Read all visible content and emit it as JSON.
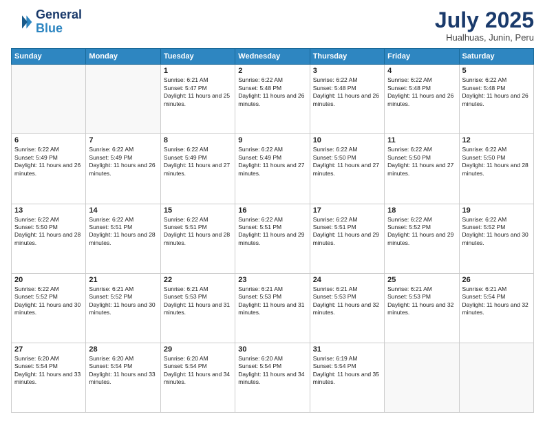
{
  "header": {
    "logo_line1": "General",
    "logo_line2": "Blue",
    "month_year": "July 2025",
    "location": "Hualhuas, Junin, Peru"
  },
  "days_of_week": [
    "Sunday",
    "Monday",
    "Tuesday",
    "Wednesday",
    "Thursday",
    "Friday",
    "Saturday"
  ],
  "weeks": [
    [
      {
        "day": "",
        "sunrise": "",
        "sunset": "",
        "daylight": ""
      },
      {
        "day": "",
        "sunrise": "",
        "sunset": "",
        "daylight": ""
      },
      {
        "day": "1",
        "sunrise": "Sunrise: 6:21 AM",
        "sunset": "Sunset: 5:47 PM",
        "daylight": "Daylight: 11 hours and 25 minutes."
      },
      {
        "day": "2",
        "sunrise": "Sunrise: 6:22 AM",
        "sunset": "Sunset: 5:48 PM",
        "daylight": "Daylight: 11 hours and 26 minutes."
      },
      {
        "day": "3",
        "sunrise": "Sunrise: 6:22 AM",
        "sunset": "Sunset: 5:48 PM",
        "daylight": "Daylight: 11 hours and 26 minutes."
      },
      {
        "day": "4",
        "sunrise": "Sunrise: 6:22 AM",
        "sunset": "Sunset: 5:48 PM",
        "daylight": "Daylight: 11 hours and 26 minutes."
      },
      {
        "day": "5",
        "sunrise": "Sunrise: 6:22 AM",
        "sunset": "Sunset: 5:48 PM",
        "daylight": "Daylight: 11 hours and 26 minutes."
      }
    ],
    [
      {
        "day": "6",
        "sunrise": "Sunrise: 6:22 AM",
        "sunset": "Sunset: 5:49 PM",
        "daylight": "Daylight: 11 hours and 26 minutes."
      },
      {
        "day": "7",
        "sunrise": "Sunrise: 6:22 AM",
        "sunset": "Sunset: 5:49 PM",
        "daylight": "Daylight: 11 hours and 26 minutes."
      },
      {
        "day": "8",
        "sunrise": "Sunrise: 6:22 AM",
        "sunset": "Sunset: 5:49 PM",
        "daylight": "Daylight: 11 hours and 27 minutes."
      },
      {
        "day": "9",
        "sunrise": "Sunrise: 6:22 AM",
        "sunset": "Sunset: 5:49 PM",
        "daylight": "Daylight: 11 hours and 27 minutes."
      },
      {
        "day": "10",
        "sunrise": "Sunrise: 6:22 AM",
        "sunset": "Sunset: 5:50 PM",
        "daylight": "Daylight: 11 hours and 27 minutes."
      },
      {
        "day": "11",
        "sunrise": "Sunrise: 6:22 AM",
        "sunset": "Sunset: 5:50 PM",
        "daylight": "Daylight: 11 hours and 27 minutes."
      },
      {
        "day": "12",
        "sunrise": "Sunrise: 6:22 AM",
        "sunset": "Sunset: 5:50 PM",
        "daylight": "Daylight: 11 hours and 28 minutes."
      }
    ],
    [
      {
        "day": "13",
        "sunrise": "Sunrise: 6:22 AM",
        "sunset": "Sunset: 5:50 PM",
        "daylight": "Daylight: 11 hours and 28 minutes."
      },
      {
        "day": "14",
        "sunrise": "Sunrise: 6:22 AM",
        "sunset": "Sunset: 5:51 PM",
        "daylight": "Daylight: 11 hours and 28 minutes."
      },
      {
        "day": "15",
        "sunrise": "Sunrise: 6:22 AM",
        "sunset": "Sunset: 5:51 PM",
        "daylight": "Daylight: 11 hours and 28 minutes."
      },
      {
        "day": "16",
        "sunrise": "Sunrise: 6:22 AM",
        "sunset": "Sunset: 5:51 PM",
        "daylight": "Daylight: 11 hours and 29 minutes."
      },
      {
        "day": "17",
        "sunrise": "Sunrise: 6:22 AM",
        "sunset": "Sunset: 5:51 PM",
        "daylight": "Daylight: 11 hours and 29 minutes."
      },
      {
        "day": "18",
        "sunrise": "Sunrise: 6:22 AM",
        "sunset": "Sunset: 5:52 PM",
        "daylight": "Daylight: 11 hours and 29 minutes."
      },
      {
        "day": "19",
        "sunrise": "Sunrise: 6:22 AM",
        "sunset": "Sunset: 5:52 PM",
        "daylight": "Daylight: 11 hours and 30 minutes."
      }
    ],
    [
      {
        "day": "20",
        "sunrise": "Sunrise: 6:22 AM",
        "sunset": "Sunset: 5:52 PM",
        "daylight": "Daylight: 11 hours and 30 minutes."
      },
      {
        "day": "21",
        "sunrise": "Sunrise: 6:21 AM",
        "sunset": "Sunset: 5:52 PM",
        "daylight": "Daylight: 11 hours and 30 minutes."
      },
      {
        "day": "22",
        "sunrise": "Sunrise: 6:21 AM",
        "sunset": "Sunset: 5:53 PM",
        "daylight": "Daylight: 11 hours and 31 minutes."
      },
      {
        "day": "23",
        "sunrise": "Sunrise: 6:21 AM",
        "sunset": "Sunset: 5:53 PM",
        "daylight": "Daylight: 11 hours and 31 minutes."
      },
      {
        "day": "24",
        "sunrise": "Sunrise: 6:21 AM",
        "sunset": "Sunset: 5:53 PM",
        "daylight": "Daylight: 11 hours and 32 minutes."
      },
      {
        "day": "25",
        "sunrise": "Sunrise: 6:21 AM",
        "sunset": "Sunset: 5:53 PM",
        "daylight": "Daylight: 11 hours and 32 minutes."
      },
      {
        "day": "26",
        "sunrise": "Sunrise: 6:21 AM",
        "sunset": "Sunset: 5:54 PM",
        "daylight": "Daylight: 11 hours and 32 minutes."
      }
    ],
    [
      {
        "day": "27",
        "sunrise": "Sunrise: 6:20 AM",
        "sunset": "Sunset: 5:54 PM",
        "daylight": "Daylight: 11 hours and 33 minutes."
      },
      {
        "day": "28",
        "sunrise": "Sunrise: 6:20 AM",
        "sunset": "Sunset: 5:54 PM",
        "daylight": "Daylight: 11 hours and 33 minutes."
      },
      {
        "day": "29",
        "sunrise": "Sunrise: 6:20 AM",
        "sunset": "Sunset: 5:54 PM",
        "daylight": "Daylight: 11 hours and 34 minutes."
      },
      {
        "day": "30",
        "sunrise": "Sunrise: 6:20 AM",
        "sunset": "Sunset: 5:54 PM",
        "daylight": "Daylight: 11 hours and 34 minutes."
      },
      {
        "day": "31",
        "sunrise": "Sunrise: 6:19 AM",
        "sunset": "Sunset: 5:54 PM",
        "daylight": "Daylight: 11 hours and 35 minutes."
      },
      {
        "day": "",
        "sunrise": "",
        "sunset": "",
        "daylight": ""
      },
      {
        "day": "",
        "sunrise": "",
        "sunset": "",
        "daylight": ""
      }
    ]
  ]
}
